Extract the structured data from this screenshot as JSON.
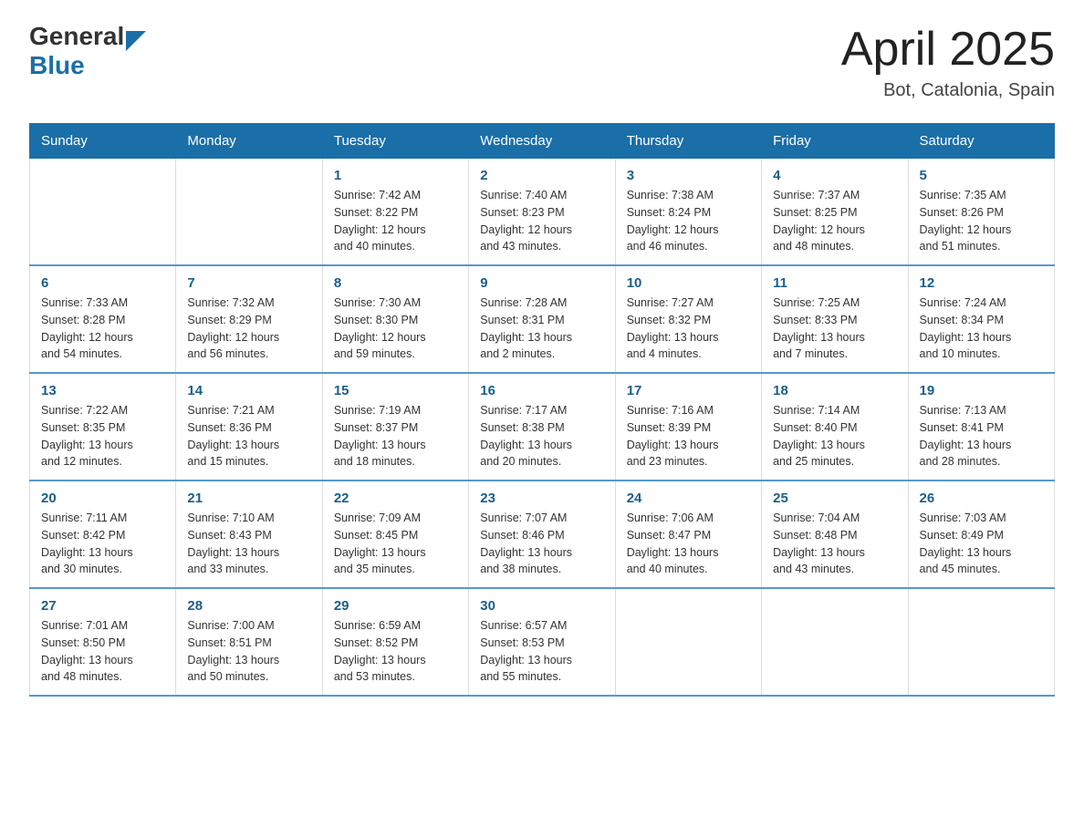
{
  "logo": {
    "general": "General",
    "blue": "Blue"
  },
  "title": "April 2025",
  "subtitle": "Bot, Catalonia, Spain",
  "headers": [
    "Sunday",
    "Monday",
    "Tuesday",
    "Wednesday",
    "Thursday",
    "Friday",
    "Saturday"
  ],
  "weeks": [
    [
      {
        "day": "",
        "info": ""
      },
      {
        "day": "",
        "info": ""
      },
      {
        "day": "1",
        "info": "Sunrise: 7:42 AM\nSunset: 8:22 PM\nDaylight: 12 hours\nand 40 minutes."
      },
      {
        "day": "2",
        "info": "Sunrise: 7:40 AM\nSunset: 8:23 PM\nDaylight: 12 hours\nand 43 minutes."
      },
      {
        "day": "3",
        "info": "Sunrise: 7:38 AM\nSunset: 8:24 PM\nDaylight: 12 hours\nand 46 minutes."
      },
      {
        "day": "4",
        "info": "Sunrise: 7:37 AM\nSunset: 8:25 PM\nDaylight: 12 hours\nand 48 minutes."
      },
      {
        "day": "5",
        "info": "Sunrise: 7:35 AM\nSunset: 8:26 PM\nDaylight: 12 hours\nand 51 minutes."
      }
    ],
    [
      {
        "day": "6",
        "info": "Sunrise: 7:33 AM\nSunset: 8:28 PM\nDaylight: 12 hours\nand 54 minutes."
      },
      {
        "day": "7",
        "info": "Sunrise: 7:32 AM\nSunset: 8:29 PM\nDaylight: 12 hours\nand 56 minutes."
      },
      {
        "day": "8",
        "info": "Sunrise: 7:30 AM\nSunset: 8:30 PM\nDaylight: 12 hours\nand 59 minutes."
      },
      {
        "day": "9",
        "info": "Sunrise: 7:28 AM\nSunset: 8:31 PM\nDaylight: 13 hours\nand 2 minutes."
      },
      {
        "day": "10",
        "info": "Sunrise: 7:27 AM\nSunset: 8:32 PM\nDaylight: 13 hours\nand 4 minutes."
      },
      {
        "day": "11",
        "info": "Sunrise: 7:25 AM\nSunset: 8:33 PM\nDaylight: 13 hours\nand 7 minutes."
      },
      {
        "day": "12",
        "info": "Sunrise: 7:24 AM\nSunset: 8:34 PM\nDaylight: 13 hours\nand 10 minutes."
      }
    ],
    [
      {
        "day": "13",
        "info": "Sunrise: 7:22 AM\nSunset: 8:35 PM\nDaylight: 13 hours\nand 12 minutes."
      },
      {
        "day": "14",
        "info": "Sunrise: 7:21 AM\nSunset: 8:36 PM\nDaylight: 13 hours\nand 15 minutes."
      },
      {
        "day": "15",
        "info": "Sunrise: 7:19 AM\nSunset: 8:37 PM\nDaylight: 13 hours\nand 18 minutes."
      },
      {
        "day": "16",
        "info": "Sunrise: 7:17 AM\nSunset: 8:38 PM\nDaylight: 13 hours\nand 20 minutes."
      },
      {
        "day": "17",
        "info": "Sunrise: 7:16 AM\nSunset: 8:39 PM\nDaylight: 13 hours\nand 23 minutes."
      },
      {
        "day": "18",
        "info": "Sunrise: 7:14 AM\nSunset: 8:40 PM\nDaylight: 13 hours\nand 25 minutes."
      },
      {
        "day": "19",
        "info": "Sunrise: 7:13 AM\nSunset: 8:41 PM\nDaylight: 13 hours\nand 28 minutes."
      }
    ],
    [
      {
        "day": "20",
        "info": "Sunrise: 7:11 AM\nSunset: 8:42 PM\nDaylight: 13 hours\nand 30 minutes."
      },
      {
        "day": "21",
        "info": "Sunrise: 7:10 AM\nSunset: 8:43 PM\nDaylight: 13 hours\nand 33 minutes."
      },
      {
        "day": "22",
        "info": "Sunrise: 7:09 AM\nSunset: 8:45 PM\nDaylight: 13 hours\nand 35 minutes."
      },
      {
        "day": "23",
        "info": "Sunrise: 7:07 AM\nSunset: 8:46 PM\nDaylight: 13 hours\nand 38 minutes."
      },
      {
        "day": "24",
        "info": "Sunrise: 7:06 AM\nSunset: 8:47 PM\nDaylight: 13 hours\nand 40 minutes."
      },
      {
        "day": "25",
        "info": "Sunrise: 7:04 AM\nSunset: 8:48 PM\nDaylight: 13 hours\nand 43 minutes."
      },
      {
        "day": "26",
        "info": "Sunrise: 7:03 AM\nSunset: 8:49 PM\nDaylight: 13 hours\nand 45 minutes."
      }
    ],
    [
      {
        "day": "27",
        "info": "Sunrise: 7:01 AM\nSunset: 8:50 PM\nDaylight: 13 hours\nand 48 minutes."
      },
      {
        "day": "28",
        "info": "Sunrise: 7:00 AM\nSunset: 8:51 PM\nDaylight: 13 hours\nand 50 minutes."
      },
      {
        "day": "29",
        "info": "Sunrise: 6:59 AM\nSunset: 8:52 PM\nDaylight: 13 hours\nand 53 minutes."
      },
      {
        "day": "30",
        "info": "Sunrise: 6:57 AM\nSunset: 8:53 PM\nDaylight: 13 hours\nand 55 minutes."
      },
      {
        "day": "",
        "info": ""
      },
      {
        "day": "",
        "info": ""
      },
      {
        "day": "",
        "info": ""
      }
    ]
  ]
}
